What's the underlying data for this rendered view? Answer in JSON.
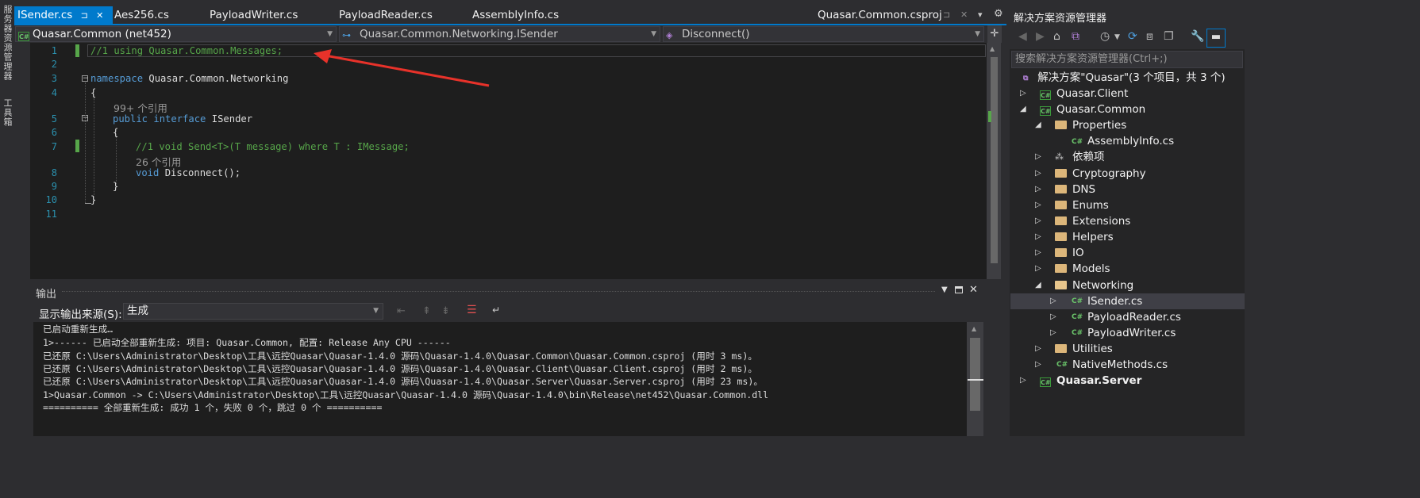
{
  "left_strip": {
    "item1": "服务器资源管理器",
    "item2": "工具箱"
  },
  "tabs": [
    {
      "label": "ISender.cs",
      "active": true
    },
    {
      "label": "Aes256.cs"
    },
    {
      "label": "PayloadWriter.cs"
    },
    {
      "label": "PayloadReader.cs"
    },
    {
      "label": "AssemblyInfo.cs"
    },
    {
      "label": "Quasar.Common.csproj"
    }
  ],
  "tab_controls": {
    "pin": "⊐",
    "close": "✕"
  },
  "navbar": {
    "project": "Quasar.Common (net452)",
    "type": "Quasar.Common.Networking.ISender",
    "member": "Disconnect()"
  },
  "editor": {
    "line_numbers": [
      "1",
      "2",
      "3",
      "4",
      "5",
      "6",
      "7",
      "8",
      "9",
      "10",
      "11"
    ],
    "line1": "//1 using Quasar.Common.Messages;",
    "line3_kw": "namespace",
    "line3_rest": " Quasar.Common.Networking",
    "line4": "{",
    "ref1": "99+ 个引用",
    "line5_kw": "public interface",
    "line5_rest": " ISender",
    "line6": "{",
    "line7": "//1 void Send<T>(T message) where T : IMessage;",
    "ref2": "26 个引用",
    "line8_kw": "void",
    "line8_rest": " Disconnect();",
    "line9": "}",
    "line10": "}"
  },
  "output": {
    "title": "输出",
    "source_label": "显示输出来源(S):",
    "source_value": "生成",
    "lines": [
      "已启动重新生成…",
      "1>------ 已启动全部重新生成: 项目: Quasar.Common, 配置: Release Any CPU ------",
      "已还原 C:\\Users\\Administrator\\Desktop\\工具\\远控Quasar\\Quasar-1.4.0 源码\\Quasar-1.4.0\\Quasar.Common\\Quasar.Common.csproj (用时 3 ms)。",
      "已还原 C:\\Users\\Administrator\\Desktop\\工具\\远控Quasar\\Quasar-1.4.0 源码\\Quasar-1.4.0\\Quasar.Client\\Quasar.Client.csproj (用时 2 ms)。",
      "已还原 C:\\Users\\Administrator\\Desktop\\工具\\远控Quasar\\Quasar-1.4.0 源码\\Quasar-1.4.0\\Quasar.Server\\Quasar.Server.csproj (用时 23 ms)。",
      "1>Quasar.Common -> C:\\Users\\Administrator\\Desktop\\工具\\远控Quasar\\Quasar-1.4.0 源码\\Quasar-1.4.0\\bin\\Release\\net452\\Quasar.Common.dll",
      "========== 全部重新生成: 成功 1 个，失败 0 个，跳过 0 个 =========="
    ]
  },
  "solution_explorer": {
    "title": "解决方案资源管理器",
    "search_placeholder": "搜索解决方案资源管理器(Ctrl+;)",
    "solution": "解决方案\"Quasar\"(3 个项目，共 3 个)",
    "items": [
      {
        "label": "Quasar.Client",
        "icon": "cs-project-icon"
      },
      {
        "label": "Quasar.Common",
        "icon": "cs-project-icon"
      },
      {
        "label": "Properties",
        "icon": "properties-folder-icon"
      },
      {
        "label": "AssemblyInfo.cs",
        "icon": "cs-file-icon"
      },
      {
        "label": "依赖项",
        "icon": "dependencies-icon"
      },
      {
        "label": "Cryptography",
        "icon": "folder-icon"
      },
      {
        "label": "DNS",
        "icon": "folder-icon"
      },
      {
        "label": "Enums",
        "icon": "folder-icon"
      },
      {
        "label": "Extensions",
        "icon": "folder-icon"
      },
      {
        "label": "Helpers",
        "icon": "folder-icon"
      },
      {
        "label": "IO",
        "icon": "folder-icon"
      },
      {
        "label": "Models",
        "icon": "folder-icon"
      },
      {
        "label": "Networking",
        "icon": "open-folder-icon"
      },
      {
        "label": "ISender.cs",
        "icon": "cs-file-icon"
      },
      {
        "label": "PayloadReader.cs",
        "icon": "cs-file-icon"
      },
      {
        "label": "PayloadWriter.cs",
        "icon": "cs-file-icon"
      },
      {
        "label": "Utilities",
        "icon": "folder-icon"
      },
      {
        "label": "NativeMethods.cs",
        "icon": "cs-file-icon"
      },
      {
        "label": "Quasar.Server",
        "icon": "cs-project-icon"
      }
    ]
  },
  "colors": {
    "accent": "#007acc",
    "annotation_arrow": "#e8322a",
    "comment": "#57a64a",
    "keyword": "#569cd6",
    "line_number": "#2b91af"
  }
}
